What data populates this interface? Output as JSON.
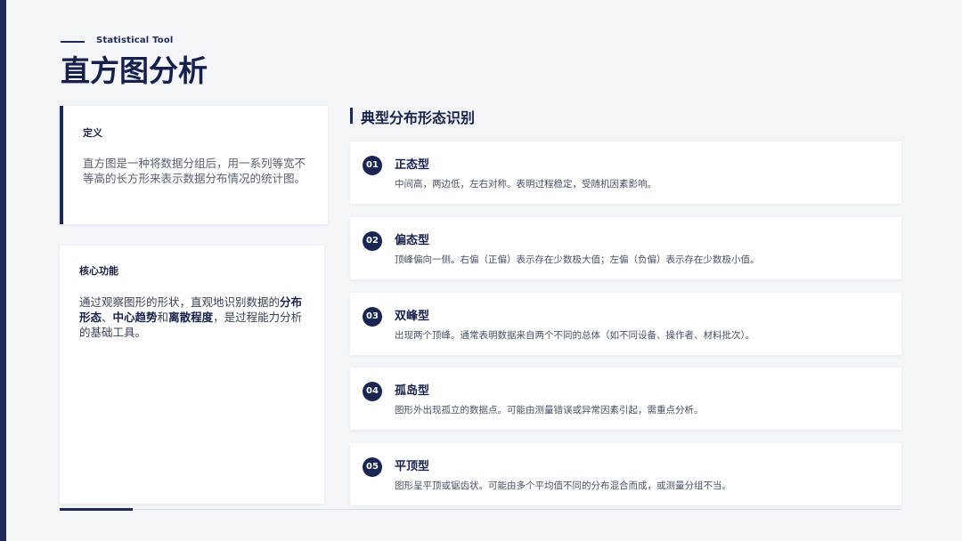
{
  "header": {
    "tag": "Statistical Tool",
    "title": "直方图分析"
  },
  "definition": {
    "label": "定义",
    "text": "直方图是一种将数据分组后，用一系列等宽不等高的长方形来表示数据分布情况的统计图。"
  },
  "core": {
    "label": "核心功能",
    "text_before": "通过观察图形的形状，直观地识别数据的",
    "bold1": "分布形态",
    "sep1": "、",
    "bold2": "中心趋势",
    "sep2": "和",
    "bold3": "离散程度",
    "text_after": "，是过程能力分析的基础工具。"
  },
  "section": {
    "title": "典型分布形态识别"
  },
  "items": [
    {
      "num": "01",
      "title": "正态型",
      "desc": "中间高，两边低，左右对称。表明过程稳定，受随机因素影响。"
    },
    {
      "num": "02",
      "title": "偏态型",
      "desc": "顶峰偏向一侧。右偏（正偏）表示存在少数极大值；左偏（负偏）表示存在少数极小值。"
    },
    {
      "num": "03",
      "title": "双峰型",
      "desc": "出现两个顶峰。通常表明数据来自两个不同的总体（如不同设备、操作者、材料批次）。"
    },
    {
      "num": "04",
      "title": "孤岛型",
      "desc": "图形外出现孤立的数据点。可能由测量错误或异常因素引起，需重点分析。"
    },
    {
      "num": "05",
      "title": "平顶型",
      "desc": "图形呈平顶或锯齿状。可能由多个平均值不同的分布混合而成，或测量分组不当。"
    }
  ],
  "colors": {
    "accent": "#1e2a5a",
    "background": "#f4f5f8"
  }
}
